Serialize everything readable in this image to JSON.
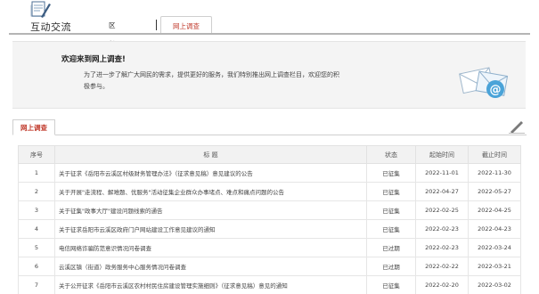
{
  "header": {
    "logo_text": "互动交流",
    "nav": [
      {
        "label": "区长信箱"
      },
      {
        "label": "网上调查",
        "active": true
      }
    ]
  },
  "welcome": {
    "title": "欢迎来到网上调查!",
    "line1": "为了进一步了解广大网民的需求，提供更好的服务，我们特别推出网上调查栏目，欢迎您的积",
    "line2": "极参与。"
  },
  "panel": {
    "tab_label": "网上调查"
  },
  "table": {
    "headers": {
      "index": "序号",
      "title": "标 题",
      "status": "状态",
      "start": "起始时间",
      "end": "截止时间"
    },
    "rows": [
      {
        "index": "1",
        "title": "关于征求《岳阳市云溪区村级财务管理办法》（征求意见稿）意见建议的公告",
        "status": "已征集",
        "start": "2022-11-01",
        "end": "2022-11-30"
      },
      {
        "index": "2",
        "title": "关于开展\"走流程、解难题、优服务\"活动征集企业群众办事堵点、难点和痛点问题的公告",
        "status": "已征集",
        "start": "2022-04-27",
        "end": "2022-05-27"
      },
      {
        "index": "3",
        "title": "关于征集\"政事大厅\"建设问题线索的通告",
        "status": "已征集",
        "start": "2022-02-25",
        "end": "2022-04-25"
      },
      {
        "index": "4",
        "title": "关于征求岳阳市云溪区政府门户网站建设工作意见建议的通知",
        "status": "已征集",
        "start": "2022-02-23",
        "end": "2022-04-23"
      },
      {
        "index": "5",
        "title": "电信网络诈骗防范意识情况问卷调查",
        "status": "已过期",
        "start": "2022-02-23",
        "end": "2022-03-24"
      },
      {
        "index": "6",
        "title": "云溪区镇（街道）政务服务中心服务情况问卷调查",
        "status": "已过期",
        "start": "2022-02-22",
        "end": "2022-03-21"
      },
      {
        "index": "7",
        "title": "关于公开征求《岳阳市云溪区农村村民住房建设管理实施细则》（征求意见稿）意见的通知",
        "status": "已征集",
        "start": "2022-02-20",
        "end": "2022-03-02"
      }
    ]
  },
  "colors": {
    "accent": "#c0392b",
    "header_bg": "#f2f2f2",
    "welcome_bg": "#f4f4f4"
  }
}
